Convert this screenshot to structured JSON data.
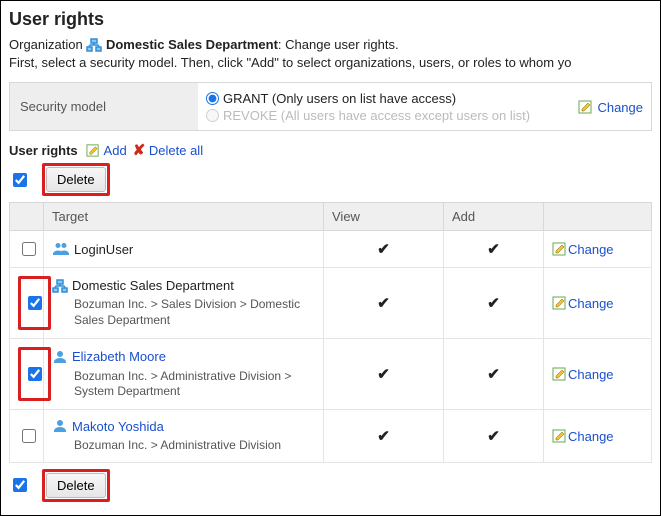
{
  "page_title": "User rights",
  "intro": {
    "org_label": "Organization",
    "org_name": "Domestic Sales Department",
    "action_sentence": ": Change user rights.",
    "instructions": "First, select a security model. Then, click \"Add\" to select organizations, users, or roles to whom yo"
  },
  "security": {
    "label": "Security model",
    "grant": "GRANT (Only users on list have access)",
    "revoke": "REVOKE (All users have access except users on list)",
    "selected": "grant",
    "change": "Change"
  },
  "section": {
    "label": "User rights",
    "add": "Add",
    "delete_all": "Delete all"
  },
  "delete_btn": "Delete",
  "columns": {
    "target": "Target",
    "view": "View",
    "add": "Add"
  },
  "change_label": "Change",
  "checkmark": "✔",
  "rows": [
    {
      "type": "group",
      "name": "LoginUser",
      "link": false,
      "path": "",
      "checked": false,
      "hl": false
    },
    {
      "type": "org",
      "name": "Domestic Sales Department",
      "link": false,
      "path": "Bozuman Inc. > Sales Division > Domestic Sales Department",
      "checked": true,
      "hl": true
    },
    {
      "type": "user",
      "name": "Elizabeth Moore",
      "link": true,
      "path": "Bozuman Inc. > Administrative Division > System Department",
      "checked": true,
      "hl": true
    },
    {
      "type": "user",
      "name": "Makoto Yoshida",
      "link": true,
      "path": "Bozuman Inc. > Administrative Division",
      "checked": false,
      "hl": false
    }
  ]
}
